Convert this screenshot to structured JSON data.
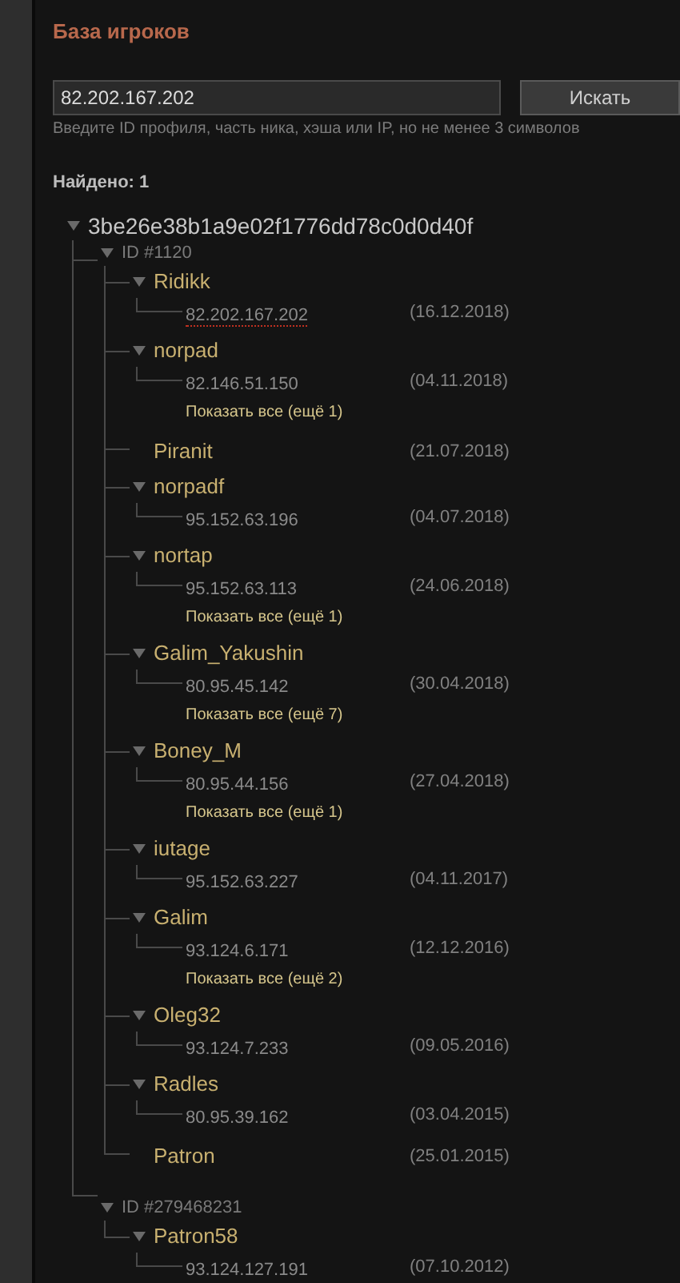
{
  "title": "База игроков",
  "search": {
    "value": "82.202.167.202",
    "button": "Искать",
    "hint": "Введите ID профиля, часть ника, хэша или IP, но не менее 3 символов"
  },
  "found": "Найдено: 1",
  "hash": "3be26e38b1a9e02f1776dd78c0d0d40f",
  "accounts": [
    {
      "id": "ID #1120",
      "players": [
        {
          "name": "Ridikk",
          "ips": [
            {
              "ip": "82.202.167.202",
              "date": "(16.12.2018)",
              "match": true
            }
          ]
        },
        {
          "name": "norpad",
          "ips": [
            {
              "ip": "82.146.51.150",
              "date": "(04.11.2018)",
              "match": false
            }
          ],
          "show_all": "Показать все (ещё 1)"
        },
        {
          "name": "Piranit",
          "date": "(21.07.2018)"
        },
        {
          "name": "norpadf",
          "ips": [
            {
              "ip": "95.152.63.196",
              "date": "(04.07.2018)",
              "match": false
            }
          ]
        },
        {
          "name": "nortap",
          "ips": [
            {
              "ip": "95.152.63.113",
              "date": "(24.06.2018)",
              "match": false
            }
          ],
          "show_all": "Показать все (ещё 1)"
        },
        {
          "name": "Galim_Yakushin",
          "ips": [
            {
              "ip": "80.95.45.142",
              "date": "(30.04.2018)",
              "match": false
            }
          ],
          "show_all": "Показать все (ещё 7)"
        },
        {
          "name": "Boney_M",
          "ips": [
            {
              "ip": "80.95.44.156",
              "date": "(27.04.2018)",
              "match": false
            }
          ],
          "show_all": "Показать все (ещё 1)"
        },
        {
          "name": "iutage",
          "ips": [
            {
              "ip": "95.152.63.227",
              "date": "(04.11.2017)",
              "match": false
            }
          ]
        },
        {
          "name": "Galim",
          "ips": [
            {
              "ip": "93.124.6.171",
              "date": "(12.12.2016)",
              "match": false
            }
          ],
          "show_all": "Показать все (ещё 2)"
        },
        {
          "name": "Oleg32",
          "ips": [
            {
              "ip": "93.124.7.233",
              "date": "(09.05.2016)",
              "match": false
            }
          ]
        },
        {
          "name": "Radles",
          "ips": [
            {
              "ip": "80.95.39.162",
              "date": "(03.04.2015)",
              "match": false
            }
          ]
        },
        {
          "name": "Patron",
          "date": "(25.01.2015)"
        }
      ]
    },
    {
      "id": "ID #279468231",
      "players": [
        {
          "name": "Patron58",
          "ips": [
            {
              "ip": "93.124.127.191",
              "date": "(07.10.2012)",
              "match": false
            }
          ]
        }
      ]
    }
  ]
}
